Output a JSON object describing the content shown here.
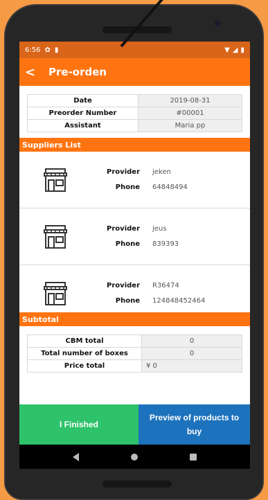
{
  "status_bar": {
    "time": "6:56"
  },
  "app_bar": {
    "back_icon": "arrow-back-icon",
    "title": "Pre-orden"
  },
  "order_info": [
    {
      "label": "Date",
      "value": "2019-08-31"
    },
    {
      "label": "Preorder Number",
      "value": "#00001"
    },
    {
      "label": "Assistant",
      "value": "Maria pp"
    }
  ],
  "suppliers_header": "Suppliers List",
  "suppliers": [
    {
      "provider_label": "Provider",
      "provider": "jeken",
      "phone_label": "Phone",
      "phone": "64848494"
    },
    {
      "provider_label": "Provider",
      "provider": "jeus",
      "phone_label": "Phone",
      "phone": "839393"
    },
    {
      "provider_label": "Provider",
      "provider": "R36474",
      "phone_label": "Phone",
      "phone": "124848452464"
    }
  ],
  "subtotal_header": "Subtotal",
  "subtotal": [
    {
      "label": "CBM total",
      "value": "0"
    },
    {
      "label": "Total number of boxes",
      "value": "0"
    },
    {
      "label": "Price total",
      "value": "¥ 0"
    }
  ],
  "actions": {
    "finish": "I Finished",
    "preview": "Preview of products to buy"
  },
  "colors": {
    "accent": "#FF7411",
    "status": "#D9651A",
    "finish": "#2EC26A",
    "preview": "#1D72BD"
  }
}
